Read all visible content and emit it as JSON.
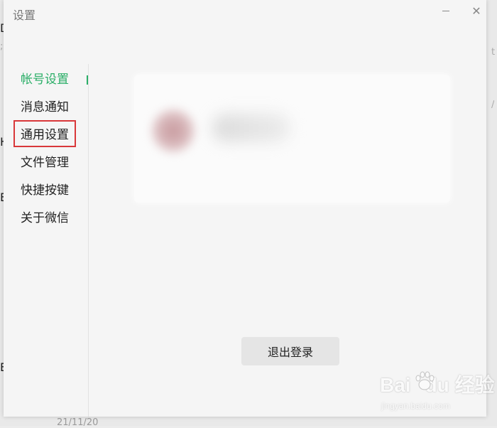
{
  "window": {
    "title": "设置",
    "minimize_icon": "minimize-icon",
    "close_glyph": "✕"
  },
  "sidebar": {
    "items": [
      {
        "label": "帐号设置",
        "active": true
      },
      {
        "label": "消息通知",
        "active": false
      },
      {
        "label": "通用设置",
        "active": false,
        "highlighted": true
      },
      {
        "label": "文件管理",
        "active": false
      },
      {
        "label": "快捷按键",
        "active": false
      },
      {
        "label": "关于微信",
        "active": false
      }
    ]
  },
  "account": {
    "avatar_icon": "avatar"
  },
  "actions": {
    "logout_label": "退出登录"
  },
  "background": {
    "date": "21/11/20"
  },
  "watermark": {
    "brand": "Bai du 经验",
    "url": "jingyan.baidu.com"
  },
  "colors": {
    "accent": "#2aae67",
    "highlight_border": "#d9383a",
    "panel": "#f5f5f5",
    "button": "#e5e5e5"
  }
}
